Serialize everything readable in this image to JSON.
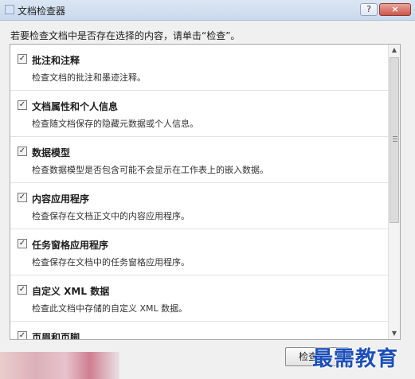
{
  "window": {
    "title": "文档检查器",
    "help_glyph": "?",
    "close_glyph": "×"
  },
  "instruction": "若要检查文档中是否存在选择的内容，请单击“检查”。",
  "items": [
    {
      "checked": true,
      "title": "批注和注释",
      "desc": "检查文档的批注和墨迹注释。"
    },
    {
      "checked": true,
      "title": "文档属性和个人信息",
      "desc": "检查随文档保存的隐藏元数据或个人信息。"
    },
    {
      "checked": true,
      "title": "数据模型",
      "desc": "检查数据模型是否包含可能不会显示在工作表上的嵌入数据。"
    },
    {
      "checked": true,
      "title": "内容应用程序",
      "desc": "检查保存在文档正文中的内容应用程序。"
    },
    {
      "checked": true,
      "title": "任务窗格应用程序",
      "desc": "检查保存在文档中的任务窗格应用程序。"
    },
    {
      "checked": true,
      "title": "自定义 XML 数据",
      "desc": "检查此文档中存储的自定义 XML 数据。"
    }
  ],
  "partial_item": {
    "title": "页眉和页脚"
  },
  "check_mark": "✓",
  "scroll": {
    "up_glyph": "▲",
    "down_glyph": "▼"
  },
  "buttons": {
    "inspect_label": "检查(I)"
  },
  "watermark": "最需教育",
  "colors": {
    "titlebar": "#c9d9ec",
    "watermark": "#1c4fb8",
    "close": "#c9584b"
  }
}
